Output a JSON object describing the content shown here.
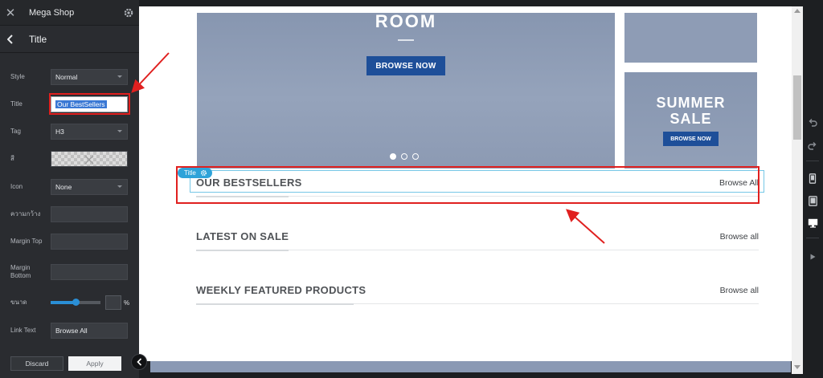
{
  "sidebar": {
    "app_title": "Mega Shop",
    "section_title": "Title",
    "fields": {
      "style": {
        "label": "Style",
        "value": "Normal"
      },
      "title": {
        "label": "Title",
        "value": "Our BestSellers"
      },
      "tag": {
        "label": "Tag",
        "value": "H3"
      },
      "color": {
        "label": "สี"
      },
      "icon": {
        "label": "Icon",
        "value": "None"
      },
      "width": {
        "label": "ความกว้าง",
        "value": ""
      },
      "margin_top": {
        "label": "Margin Top",
        "value": ""
      },
      "margin_bottom": {
        "label": "Margin Bottom",
        "value": ""
      },
      "size": {
        "label": "ขนาด",
        "unit": "%",
        "level": 0.5
      },
      "link_text": {
        "label": "Link Text",
        "value": "Browse All"
      }
    },
    "discard_label": "Discard",
    "apply_label": "Apply"
  },
  "canvas": {
    "hero": {
      "heading": "ROOM",
      "button": "BROWSE NOW",
      "slides": 3,
      "active_slide": 1
    },
    "promo": {
      "line1": "SUMMER",
      "line2": "SALE",
      "button": "BROWSE NOW"
    },
    "title_tag": "Title",
    "sections": [
      {
        "heading": "OUR BESTSELLERS",
        "link": "Browse All"
      },
      {
        "heading": "LATEST ON SALE",
        "link": "Browse all"
      },
      {
        "heading": "WEEKLY FEATURED PRODUCTS",
        "link": "Browse all"
      }
    ]
  },
  "colors": {
    "accent": "#2ea3d9",
    "primary_button": "#1e4f99",
    "highlight": "#e0201f"
  },
  "toolbar_icons": [
    "undo-icon",
    "redo-icon",
    "mobile-view-icon",
    "tablet-view-icon",
    "desktop-view-icon",
    "play-icon"
  ]
}
